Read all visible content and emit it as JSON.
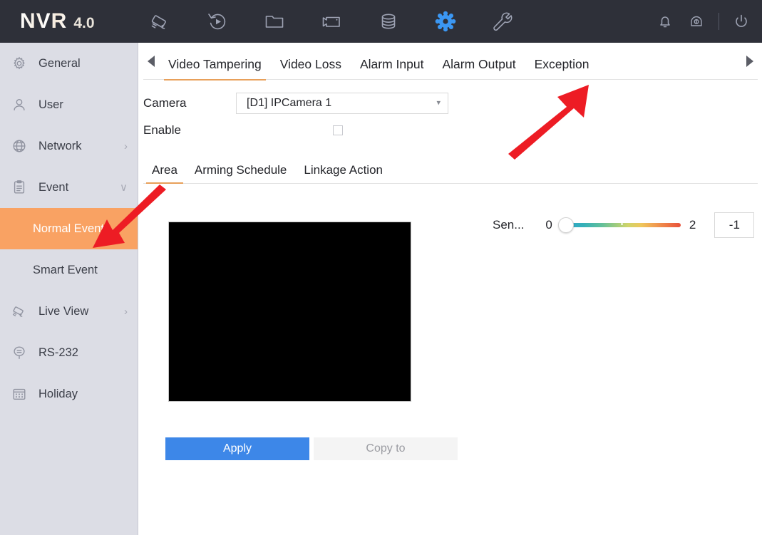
{
  "header": {
    "logo_name": "NVR",
    "logo_version": "4.0",
    "icons": [
      {
        "name": "camera-icon",
        "label": "Camera"
      },
      {
        "name": "playback-icon",
        "label": "Playback"
      },
      {
        "name": "file-folder-icon",
        "label": "File"
      },
      {
        "name": "video-export-icon",
        "label": "Export"
      },
      {
        "name": "storage-icon",
        "label": "Storage"
      },
      {
        "name": "settings-gear-icon",
        "label": "Settings"
      },
      {
        "name": "maintenance-wrench-icon",
        "label": "Maintenance"
      }
    ],
    "right_icons": [
      {
        "name": "bell-alarm-icon",
        "label": "Alarm"
      },
      {
        "name": "siren-icon",
        "label": "Alert"
      },
      {
        "name": "power-icon",
        "label": "Power"
      }
    ],
    "active_icon": "settings-gear-icon",
    "bg_color": "#2e3039",
    "accent_color": "#3b97f3"
  },
  "sidebar": {
    "bg_color": "#dcdde5",
    "selected_color": "#f9a263",
    "items": [
      {
        "label": "General",
        "icon": "gear-icon",
        "chevron": "",
        "selected": false,
        "sub": false
      },
      {
        "label": "User",
        "icon": "user-icon",
        "chevron": "",
        "selected": false,
        "sub": false
      },
      {
        "label": "Network",
        "icon": "globe-icon",
        "chevron": "›",
        "selected": false,
        "sub": false
      },
      {
        "label": "Event",
        "icon": "clipboard-icon",
        "chevron": "∨",
        "selected": false,
        "sub": false
      },
      {
        "label": "Normal Event",
        "icon": "",
        "chevron": "",
        "selected": true,
        "sub": true
      },
      {
        "label": "Smart Event",
        "icon": "",
        "chevron": "",
        "selected": false,
        "sub": true
      },
      {
        "label": "Live View",
        "icon": "camera-icon",
        "chevron": "›",
        "selected": false,
        "sub": false
      },
      {
        "label": "RS-232",
        "icon": "serial-port-icon",
        "chevron": "",
        "selected": false,
        "sub": false
      },
      {
        "label": "Holiday",
        "icon": "calendar-icon",
        "chevron": "",
        "selected": false,
        "sub": false
      }
    ]
  },
  "main": {
    "tab_prev_label": "◀",
    "tab_next_label": "▶",
    "tabs": [
      {
        "label": "Video Tampering",
        "active": true
      },
      {
        "label": "Video Loss",
        "active": false
      },
      {
        "label": "Alarm Input",
        "active": false
      },
      {
        "label": "Alarm Output",
        "active": false
      },
      {
        "label": "Exception",
        "active": false
      }
    ],
    "camera_label": "Camera",
    "camera_value": "[D1] IPCamera 1",
    "camera_caret": "▾",
    "enable_label": "Enable",
    "enable_checked": false,
    "subtabs": [
      {
        "label": "Area",
        "active": true
      },
      {
        "label": "Arming Schedule",
        "active": false
      },
      {
        "label": "Linkage Action",
        "active": false
      }
    ],
    "sensitivity_label": "Sen...",
    "sensitivity_min": "0",
    "sensitivity_max": "2",
    "sensitivity_value": "-1",
    "apply_label": "Apply",
    "copy_to_label": "Copy to",
    "apply_color": "#3d87e8"
  },
  "annotations": {
    "arrow_color": "#ed1c24",
    "arrows": [
      {
        "name": "arrow-to-exception-tab",
        "target": "Exception"
      },
      {
        "name": "arrow-to-normal-event",
        "target": "Normal Event"
      }
    ]
  }
}
